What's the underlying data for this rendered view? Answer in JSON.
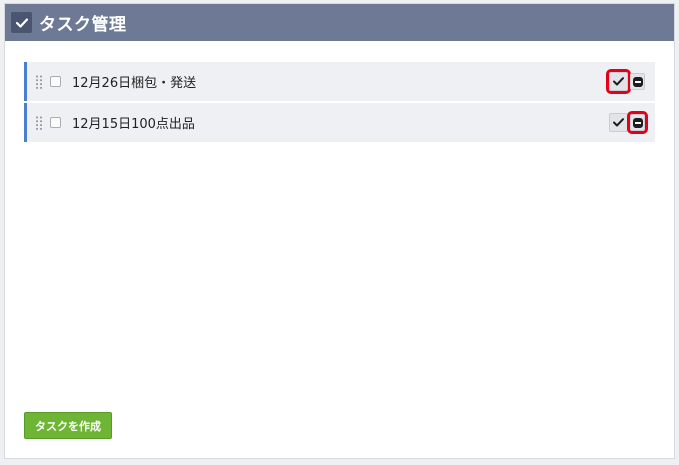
{
  "panel": {
    "title": "タスク管理",
    "icon": "check-icon"
  },
  "tasks": [
    {
      "label": "12月26日梱包・発送",
      "checked": false,
      "highlighted_action": "complete"
    },
    {
      "label": "12月15日100点出品",
      "checked": false,
      "highlighted_action": "remove"
    }
  ],
  "actions": {
    "create_label": "タスクを作成"
  },
  "colors": {
    "header_bg": "#6e7a95",
    "row_accent": "#4a7fd0",
    "create_button": "#6fb535",
    "highlight": "#e3001b"
  }
}
